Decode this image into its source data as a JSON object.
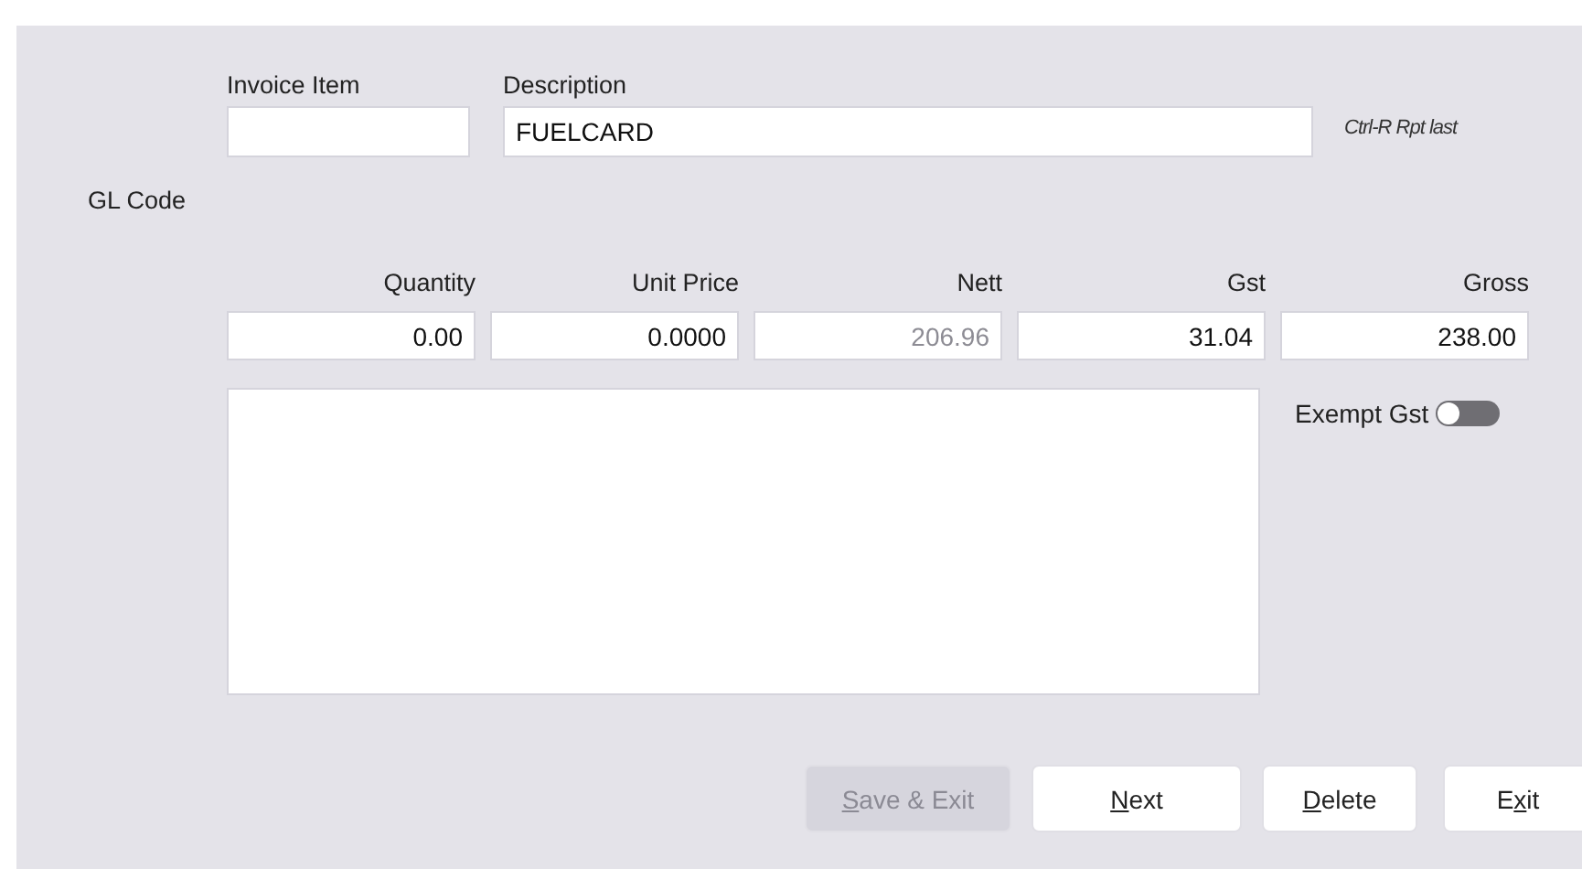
{
  "invoice_item": {
    "label": "Invoice Item"
  },
  "description": {
    "label": "Description",
    "value": "FUELCARD"
  },
  "hint": "Ctrl-R Rpt last",
  "gl_code": {
    "label": "GL Code"
  },
  "amounts": [
    {
      "label": "Quantity",
      "value": "0.00",
      "disabled": false
    },
    {
      "label": "Unit Price",
      "value": "0.0000",
      "disabled": false
    },
    {
      "label": "Nett",
      "value": "206.96",
      "disabled": true
    },
    {
      "label": "Gst",
      "value": "31.04",
      "disabled": false
    },
    {
      "label": "Gross",
      "value": "238.00",
      "disabled": false
    }
  ],
  "exempt_gst": {
    "label": "Exempt Gst",
    "on": false
  },
  "buttons": [
    {
      "key": "S",
      "after": "ave & Exit",
      "disabled": true
    },
    {
      "key": "N",
      "after": "ext",
      "disabled": false
    },
    {
      "key": "D",
      "after": "elete",
      "disabled": false
    },
    {
      "before": "E",
      "key": "x",
      "after": "it",
      "disabled": false
    }
  ]
}
